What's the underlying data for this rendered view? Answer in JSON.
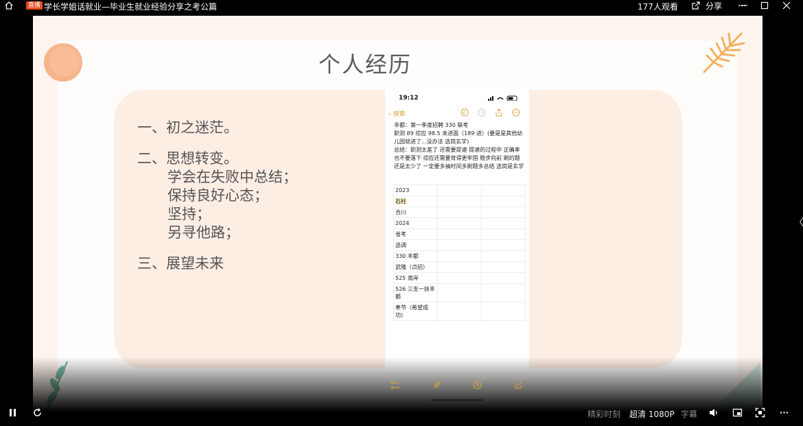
{
  "topbar": {
    "badge": "直播",
    "title": "学长学姐话就业—毕业生就业经验分享之考公篇",
    "viewers": "177人观看",
    "share": "分享"
  },
  "slide": {
    "title": "个人经历",
    "outline": {
      "s1": "一、初之迷茫。",
      "s2": "二、思想转变。",
      "s2_items": [
        "学会在失败中总结；",
        "保持良好心态；",
        "坚持；",
        "另寻他路；"
      ],
      "s3": "三、展望未来"
    }
  },
  "phone": {
    "time": "19:12",
    "back": "搜索",
    "notes": [
      "丰都：第一季度招聘 330 联考",
      "职测 89 综应 98.5 未进面（189 进）(要是是其他幼儿园就进了...没办法 选岗玄学)",
      "总结：职测太差了 还需要提速 提速的过程中 正确率也不要落下 综应还需要背得更牢固 稳步向前 刷的题还是太少了 一定要多抽时间多刷题多总结 选岗是玄学"
    ],
    "table": [
      "2023",
      "石柱",
      "合川",
      "2024",
      "省考",
      "选调",
      "330 丰都",
      "武隆（点招）",
      "525 南岸",
      "526 三支一扶丰都",
      "奉节（希望成功)"
    ]
  },
  "controls": {
    "highlights": "精彩时刻",
    "quality": "超清 1080P",
    "subtitles": "字幕"
  },
  "colors": {
    "accent": "#e8491d",
    "blob": "#fdeee4",
    "notes_accent": "#d9a33a"
  }
}
